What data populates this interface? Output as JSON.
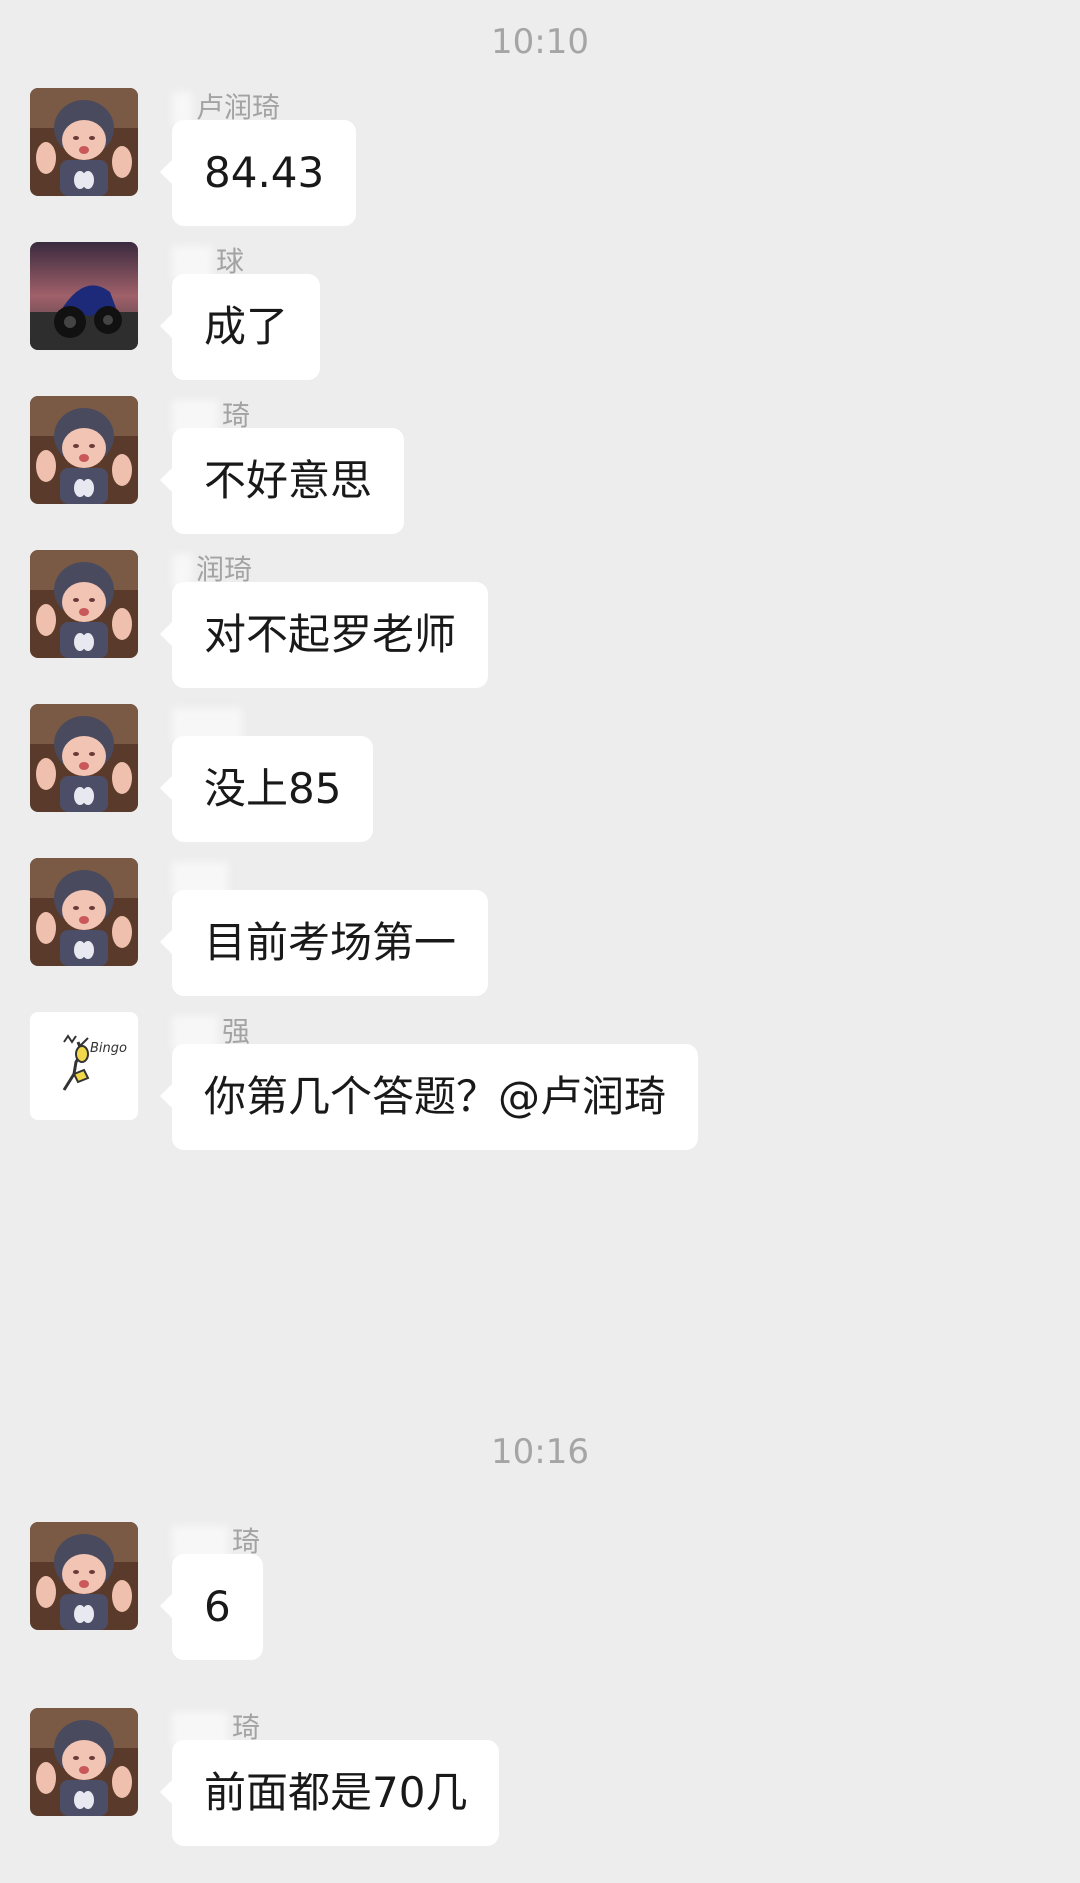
{
  "timestamps": [
    "10:10",
    "10:16"
  ],
  "messages": [
    {
      "sender": "卢润琦",
      "avatar": "baby-avatar",
      "text": "84.43"
    },
    {
      "sender": "球",
      "avatar": "motorcycle-avatar",
      "text": "成了"
    },
    {
      "sender": "琦",
      "avatar": "baby-avatar",
      "text": "不好意思"
    },
    {
      "sender": "润琦",
      "avatar": "baby-avatar",
      "text": "对不起罗老师"
    },
    {
      "sender": "",
      "avatar": "baby-avatar",
      "text": "没上85"
    },
    {
      "sender": "",
      "avatar": "baby-avatar",
      "text": "目前考场第一"
    },
    {
      "sender": "强",
      "avatar": "bingo-sticker-avatar",
      "text": "你第几个答题？@卢润琦"
    },
    {
      "sender": "琦",
      "avatar": "baby-avatar",
      "text": "6"
    },
    {
      "sender": "琦",
      "avatar": "baby-avatar",
      "text": "前面都是70几"
    }
  ],
  "bingo_label": "Bingo",
  "colors": {
    "background": "#ededed",
    "bubble": "#ffffff",
    "timestamp": "#a5a5a5",
    "sender": "#a3a3a3",
    "text": "#191919"
  }
}
